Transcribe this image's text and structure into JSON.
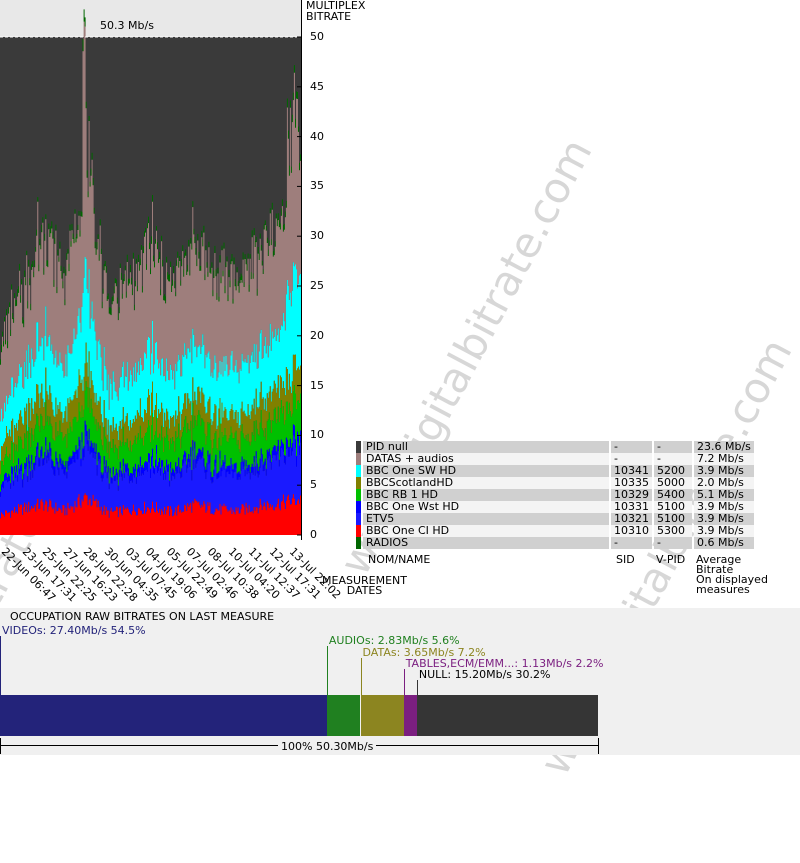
{
  "colors": {
    "null_pid": "#3a3a3a",
    "datas_audios": "#9e7e7c",
    "bbc_one_sw": "#00ffff",
    "bbcscotland": "#808000",
    "bbc_rb1": "#00c000",
    "bbc_wst": "#0000ff",
    "etv5": "#1a1aff",
    "bbc_ci": "#ff0000",
    "radios": "#006600",
    "videos": "#23237a",
    "audios": "#208020",
    "datas": "#8c8520",
    "tables": "#7b1f80",
    "null_bar": "#353535"
  },
  "chart_data": {
    "type": "area",
    "title": "50.3 Mb/s",
    "ylabel": "MULTIPLEX BITRATE",
    "xlabel": "MEASUREMENT DATES",
    "ylim": [
      0,
      50
    ],
    "yticks": [
      "0",
      "5",
      "10",
      "15",
      "20",
      "25",
      "30",
      "35",
      "40",
      "45",
      "50"
    ],
    "x": [
      "22-Jun 06:47",
      "23-Jun 17:31",
      "25-Jun 22:25",
      "27-Jun 16:23",
      "28-Jun 22:28",
      "30-Jun 04:35",
      "03-Jul 07:45",
      "04-Jul 19:06",
      "05-Jul 22:49",
      "07-Jul 02:46",
      "08-Jul 10:38",
      "10-Jul 04:20",
      "11-Jul 12:37",
      "12-Jul 17:31",
      "13-Jul 22:02"
    ],
    "series": [
      {
        "name": "BBC One CI HD",
        "values": [
          2.0,
          2.6,
          3.1,
          2.4,
          3.8,
          2.2,
          2.5,
          2.8,
          2.3,
          3.0,
          2.6,
          2.4,
          2.9,
          3.2,
          3.6
        ]
      },
      {
        "name": "ETV5",
        "values": [
          2.8,
          3.4,
          4.6,
          3.5,
          5.2,
          3.1,
          3.6,
          4.2,
          3.4,
          4.4,
          3.7,
          3.5,
          4.1,
          4.6,
          5.2
        ]
      },
      {
        "name": "BBC One Wst HD",
        "values": [
          0.6,
          0.7,
          0.9,
          0.7,
          1.1,
          0.6,
          0.7,
          0.8,
          0.7,
          0.9,
          0.7,
          0.7,
          0.8,
          0.9,
          1.0
        ]
      },
      {
        "name": "BBC RB 1 HD",
        "values": [
          2.0,
          2.5,
          3.2,
          2.6,
          3.8,
          2.4,
          2.7,
          3.0,
          2.6,
          3.2,
          2.8,
          2.7,
          3.1,
          3.4,
          3.9
        ]
      },
      {
        "name": "BBCScotlandHD",
        "values": [
          1.8,
          2.2,
          2.8,
          2.3,
          3.2,
          2.0,
          2.3,
          2.6,
          2.2,
          2.7,
          2.4,
          2.3,
          2.6,
          2.9,
          3.3
        ]
      },
      {
        "name": "BBC One SW HD",
        "values": [
          3.2,
          4.2,
          5.4,
          4.4,
          7.2,
          4.0,
          4.6,
          5.2,
          4.3,
          5.4,
          4.7,
          4.5,
          5.0,
          5.6,
          8.0
        ]
      },
      {
        "name": "DATAS + audios",
        "values": [
          7.0,
          7.6,
          10.8,
          9.2,
          12.5,
          8.4,
          9.2,
          10.4,
          8.6,
          10.0,
          9.2,
          8.8,
          9.6,
          10.4,
          13.0
        ]
      },
      {
        "name": "RADIOS",
        "values": [
          0.6,
          0.6,
          0.6,
          0.6,
          0.6,
          0.6,
          0.6,
          0.6,
          0.6,
          0.6,
          0.6,
          0.6,
          0.6,
          0.6,
          0.6
        ]
      },
      {
        "name": "PID null",
        "values": [
          30.3,
          26.5,
          18.9,
          24.6,
          12.2,
          27.0,
          24.1,
          20.7,
          25.6,
          20.1,
          23.6,
          24.8,
          21.6,
          18.7,
          11.7
        ]
      }
    ]
  },
  "legend": {
    "rows": [
      {
        "name": "PID null",
        "sid": "-",
        "vpid": "-",
        "bitrate": "23.6 Mb/s",
        "color": "#3a3a3a",
        "shade": "a"
      },
      {
        "name": "DATAS + audios",
        "sid": "-",
        "vpid": "-",
        "bitrate": "7.2 Mb/s",
        "color": "#9e7e7c",
        "shade": "b"
      },
      {
        "name": "BBC One SW HD",
        "sid": "10341",
        "vpid": "5200",
        "bitrate": "3.9 Mb/s",
        "color": "#00ffff",
        "shade": "a"
      },
      {
        "name": "BBCScotlandHD",
        "sid": "10335",
        "vpid": "5000",
        "bitrate": "2.0 Mb/s",
        "color": "#808000",
        "shade": "b"
      },
      {
        "name": "BBC RB 1 HD",
        "sid": "10329",
        "vpid": "5400",
        "bitrate": "5.1 Mb/s",
        "color": "#00c000",
        "shade": "a"
      },
      {
        "name": "BBC One Wst HD",
        "sid": "10331",
        "vpid": "5100",
        "bitrate": "3.9 Mb/s",
        "color": "#0000ff",
        "shade": "b"
      },
      {
        "name": "ETV5",
        "sid": "10321",
        "vpid": "5100",
        "bitrate": "3.9 Mb/s",
        "color": "#1a1aff",
        "shade": "a"
      },
      {
        "name": "BBC One CI HD",
        "sid": "10310",
        "vpid": "5300",
        "bitrate": "3.9 Mb/s",
        "color": "#ff0000",
        "shade": "b"
      },
      {
        "name": "RADIOS",
        "sid": "-",
        "vpid": "-",
        "bitrate": "0.6 Mb/s",
        "color": "#006600",
        "shade": "a"
      }
    ],
    "header": {
      "name": "NOM/NAME",
      "sid": "SID",
      "vpid": "V-PID",
      "bitrate": "Average\nBitrate\nOn displayed\nmeasures"
    }
  },
  "axis": {
    "y_title": "MULTIPLEX\nBITRATE",
    "x_title": "MEASUREMENT\nDATES"
  },
  "occupation": {
    "title": "OCCUPATION RAW BITRATES ON LAST MEASURE",
    "total_label": "100%  50.30Mb/s",
    "segments": [
      {
        "key": "videos",
        "label": "VIDEOs: 27.40Mb/s  54.5%",
        "fraction": 0.545,
        "color": "#23237a"
      },
      {
        "key": "audios",
        "label": "AUDIOs: 2.83Mb/s  5.6%",
        "fraction": 0.056,
        "color": "#208020"
      },
      {
        "key": "datas",
        "label": "DATAs: 3.65Mb/s  7.2%",
        "fraction": 0.072,
        "color": "#8c8520"
      },
      {
        "key": "tables",
        "label": "TABLES,ECM/EMM...: 1.13Mb/s  2.2%",
        "fraction": 0.022,
        "color": "#7b1f80"
      },
      {
        "key": "null",
        "label": "NULL: 15.20Mb/s  30.2%",
        "fraction": 0.302,
        "color": "#353535"
      }
    ]
  },
  "watermark": "www.digitalbitrate.com"
}
